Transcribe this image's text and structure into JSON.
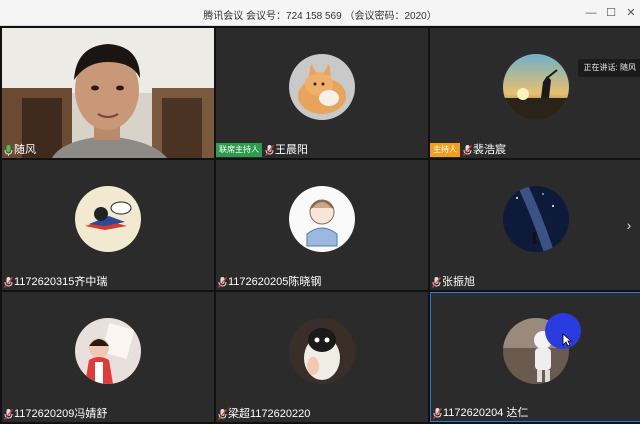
{
  "window": {
    "title": "腾讯会议  会议号：724 158 569  （会议密码：2020）",
    "controls": {
      "minimize": "—",
      "maximize": "☐",
      "close": "✕"
    }
  },
  "speaking_indicator": "正在讲话: 随风",
  "tiles": [
    {
      "name": "随风",
      "role": "",
      "video": true,
      "mic": "green"
    },
    {
      "name": "王晨阳",
      "role": "联席主持人",
      "mic": "muted"
    },
    {
      "name": "裴浩宸",
      "role": "主持人",
      "mic": "muted"
    },
    {
      "name": "1172620315齐中瑞",
      "role": "",
      "mic": "muted"
    },
    {
      "name": "1172620205陈晓钢",
      "role": "",
      "mic": "muted"
    },
    {
      "name": "张振旭",
      "role": "",
      "mic": "muted"
    },
    {
      "name": "1172620209冯婧舒",
      "role": "",
      "mic": "muted"
    },
    {
      "name": "梁超1172620220",
      "role": "",
      "mic": "muted"
    },
    {
      "name": "1172620204 达仁",
      "role": "",
      "mic": "muted"
    }
  ],
  "colors": {
    "co_host_badge": "#2e9b4f",
    "host_badge": "#f0a020",
    "active_border": "#2d7bd6",
    "cursor_highlight": "#2a3be0"
  }
}
